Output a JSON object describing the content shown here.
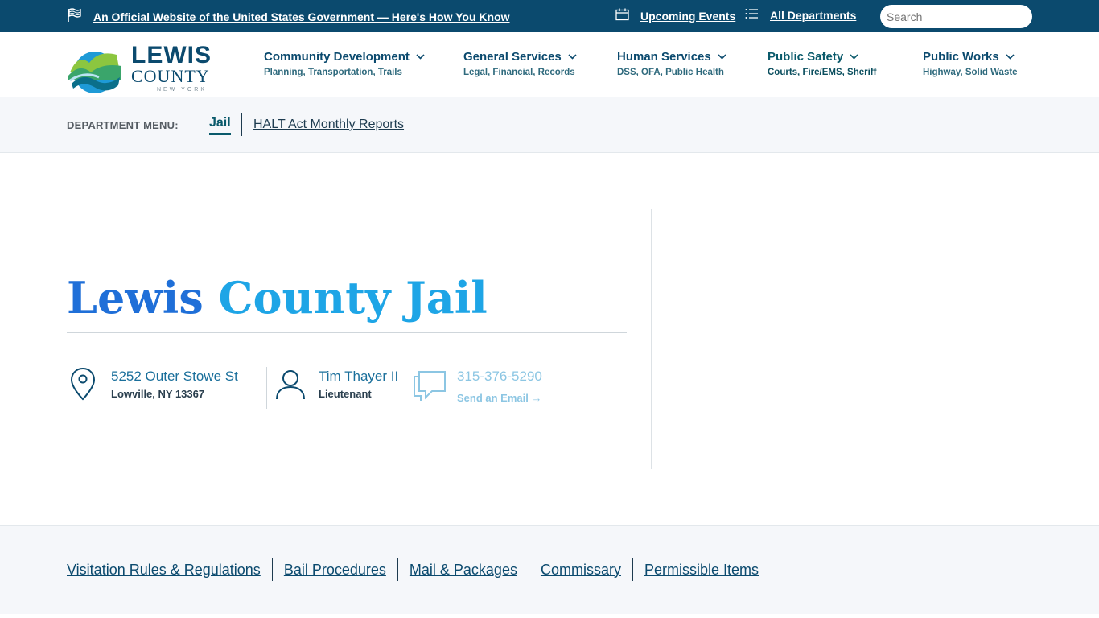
{
  "topbar": {
    "official_text": "An Official Website of the United States Government — Here's How You Know",
    "events_label": "Upcoming Events",
    "departments_label": "All Departments",
    "search_placeholder": "Search"
  },
  "logo": {
    "word1": "LEWIS",
    "word2": "COUNTY",
    "word3": "NEW YORK"
  },
  "nav": [
    {
      "title": "Community Development",
      "subtitle": "Planning, Transportation, Trails"
    },
    {
      "title": "General Services",
      "subtitle": "Legal, Financial, Records"
    },
    {
      "title": "Human Services",
      "subtitle": "DSS, OFA, Public Health"
    },
    {
      "title": "Public Safety",
      "subtitle": "Courts, Fire/EMS, Sheriff"
    },
    {
      "title": "Public Works",
      "subtitle": "Highway, Solid Waste"
    }
  ],
  "dept_menu": {
    "label": "DEPARTMENT MENU:",
    "items": [
      "Jail",
      "HALT Act Monthly Reports"
    ]
  },
  "main": {
    "title_part1": "Lewis",
    "title_part2": "County Jail",
    "address_line1": "5252 Outer Stowe St",
    "address_line2": "Lowville, NY 13367",
    "contact_name": "Tim Thayer II",
    "contact_role": "Lieutenant",
    "phone": "315-376-5290",
    "email_label": "Send an Email →"
  },
  "bottom_links": [
    "Visitation Rules & Regulations",
    "Bail Procedures",
    "Mail & Packages",
    "Commissary",
    "Permissible Items"
  ],
  "colors": {
    "topbar": "#0b4a6e",
    "title_gradient_start": "#1f6fd8",
    "title_gradient_end": "#1ea5e6",
    "accent": "#0a5a6b"
  }
}
